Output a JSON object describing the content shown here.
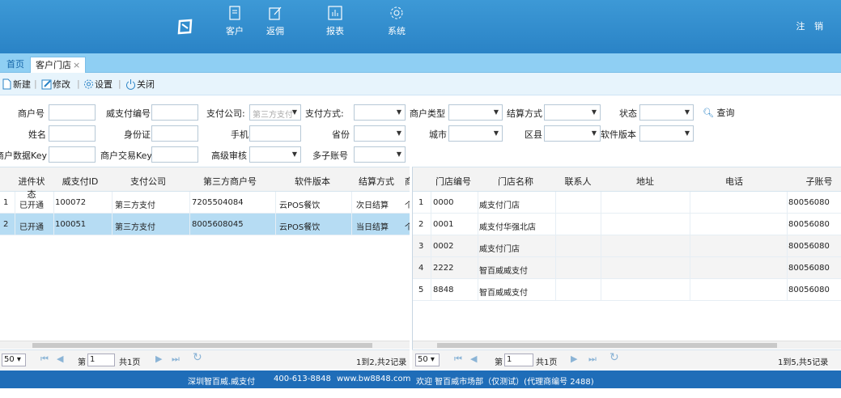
{
  "nav": {
    "items": [
      {
        "label": "客户"
      },
      {
        "label": "返佣"
      },
      {
        "label": "报表"
      },
      {
        "label": "系统"
      }
    ],
    "logout": "注 销"
  },
  "tabs": {
    "home": "首页",
    "active": "客户门店",
    "close": "×"
  },
  "toolbar": {
    "new": "新建",
    "edit": "修改",
    "settings": "设置",
    "close": "关闭"
  },
  "filters": {
    "merchant_no": "商户号",
    "wx_pay_no": "威支付编号",
    "pay_company": "支付公司:",
    "pay_company_placeholder": "第三方支付",
    "pay_method": "支付方式:",
    "merchant_type": "商户类型",
    "settle_method": "结算方式",
    "status": "状态",
    "search": "查询",
    "name": "姓名",
    "id_card": "身份证",
    "phone": "手机",
    "province": "省份",
    "city": "城市",
    "district": "区县",
    "software_version": "软件版本",
    "merchant_data_key": "商户数据Key",
    "merchant_trade_key": "商户交易Key",
    "advanced_review": "高级审核",
    "multi_sub_account": "多子账号"
  },
  "left_grid": {
    "headers": [
      "进件状态",
      "威支付ID",
      "支付公司",
      "第三方商户号",
      "软件版本",
      "结算方式",
      "商"
    ],
    "rows": [
      {
        "n": "1",
        "status": "已开通",
        "id": "100072",
        "company": "第三方支付",
        "merchant": "7205504084",
        "version": "云POS餐饮",
        "settle": "次日结算",
        "more": "个"
      },
      {
        "n": "2",
        "status": "已开通",
        "id": "100051",
        "company": "第三方支付",
        "merchant": "8005608045",
        "version": "云POS餐饮",
        "settle": "当日结算",
        "more": "个"
      }
    ]
  },
  "right_grid": {
    "headers": [
      "门店编号",
      "门店名称",
      "联系人",
      "地址",
      "电话",
      "子账号"
    ],
    "rows": [
      {
        "n": "1",
        "code": "0000",
        "name": "威支付门店",
        "sub": "80056080"
      },
      {
        "n": "2",
        "code": "0001",
        "name": "威支付华强北店",
        "sub": "80056080"
      },
      {
        "n": "3",
        "code": "0002",
        "name": "威支付门店",
        "sub": "80056080"
      },
      {
        "n": "4",
        "code": "2222",
        "name": "智百威威支付",
        "sub": "80056080"
      },
      {
        "n": "5",
        "code": "8848",
        "name": "智百威威支付",
        "sub": "80056080"
      }
    ]
  },
  "pager_left": {
    "size": "50",
    "page_prefix": "第",
    "page": "1",
    "total_pages": "共1页",
    "summary": "1到2,共2记录"
  },
  "pager_right": {
    "size": "50",
    "page_prefix": "第",
    "page": "1",
    "total_pages": "共1页",
    "summary": "1到5,共5记录"
  },
  "footer": {
    "company": "深圳智百威.威支付",
    "phone": "400-613-8848",
    "site": "www.bw8848.com",
    "welcome": "欢迎 智百威市场部（仅测试）(代理商编号 2488)"
  },
  "colors": {
    "topbar": "#2a83c6",
    "tabbar": "#8fcff3",
    "selected_row": "#b6dcf3",
    "footer": "#1f6db8"
  }
}
